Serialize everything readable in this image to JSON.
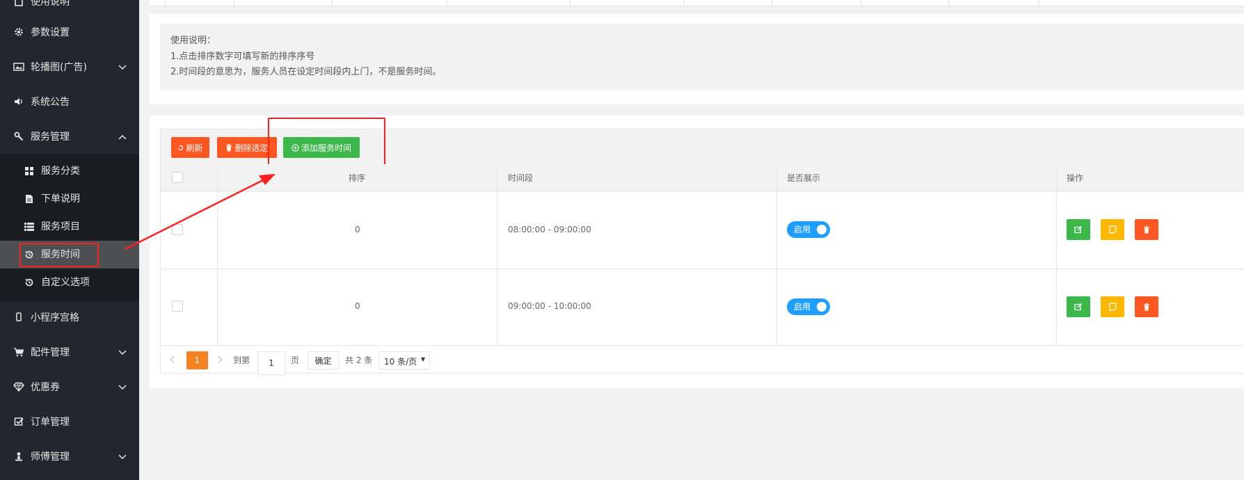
{
  "sidebar": {
    "items": [
      {
        "label": "使用说明",
        "icon": "book-icon"
      },
      {
        "label": "参数设置",
        "icon": "gear-icon"
      },
      {
        "label": "轮播图(广告)",
        "icon": "image-icon"
      },
      {
        "label": "系统公告",
        "icon": "speaker-icon"
      },
      {
        "label": "服务管理",
        "icon": "wrench-icon"
      },
      {
        "label": "小程序宫格",
        "icon": "mobile-icon"
      },
      {
        "label": "配件管理",
        "icon": "cart-icon"
      },
      {
        "label": "优惠券",
        "icon": "diamond-icon"
      },
      {
        "label": "订单管理",
        "icon": "checkbox-icon"
      },
      {
        "label": "师傅管理",
        "icon": "worker-icon"
      }
    ],
    "sub_items": [
      {
        "label": "服务分类",
        "icon": "grid-icon"
      },
      {
        "label": "下单说明",
        "icon": "document-icon"
      },
      {
        "label": "服务项目",
        "icon": "list-icon"
      },
      {
        "label": "服务时间",
        "icon": "history-icon"
      },
      {
        "label": "自定义选项",
        "icon": "history-icon"
      }
    ]
  },
  "notice": {
    "line1": "使用说明：",
    "line2": "1.点击排序数字可填写新的排序序号",
    "line3": "2.时间段的意思为，服务人员在设定时间段内上门，不是服务时间。"
  },
  "toolbar": {
    "refresh_label": "刷新",
    "delete_label": "删除选定",
    "add_label": "添加服务时间"
  },
  "table": {
    "columns": [
      "排序",
      "时间段",
      "是否展示",
      "操作"
    ],
    "rows": [
      {
        "sort": "0",
        "time": "08:00:00 - 09:00:00",
        "status": "启用"
      },
      {
        "sort": "0",
        "time": "09:00:00 - 10:00:00",
        "status": "启用"
      }
    ]
  },
  "pagination": {
    "current": "1",
    "goto_label": "到第",
    "page_value": "1",
    "page_unit": "页",
    "confirm_label": "确定",
    "total_label": "共 2 条",
    "per_page": "10 条/页"
  },
  "colors": {
    "sidebar_bg": "#23262e",
    "orange": "#ff5722",
    "green": "#3cb84a",
    "yellow": "#ffb800",
    "blue": "#1e9fff",
    "highlight_red": "#ff1f1f"
  }
}
